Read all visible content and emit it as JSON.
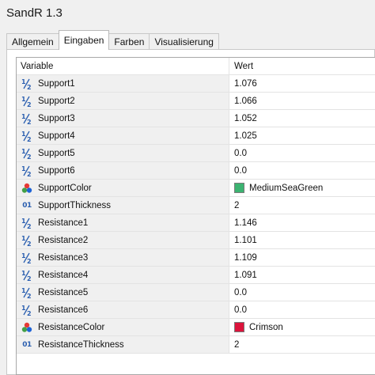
{
  "window": {
    "title": "SandR 1.3"
  },
  "tabs": [
    {
      "label": "Allgemein",
      "active": false
    },
    {
      "label": "Eingaben",
      "active": true
    },
    {
      "label": "Farben",
      "active": false
    },
    {
      "label": "Visualisierung",
      "active": false
    }
  ],
  "table": {
    "headers": {
      "variable": "Variable",
      "value": "Wert"
    },
    "rows": [
      {
        "name": "Support1",
        "value": "1.076",
        "icon": "fraction-icon"
      },
      {
        "name": "Support2",
        "value": "1.066",
        "icon": "fraction-icon"
      },
      {
        "name": "Support3",
        "value": "1.052",
        "icon": "fraction-icon"
      },
      {
        "name": "Support4",
        "value": "1.025",
        "icon": "fraction-icon"
      },
      {
        "name": "Support5",
        "value": "0.0",
        "icon": "fraction-icon"
      },
      {
        "name": "Support6",
        "value": "0.0",
        "icon": "fraction-icon"
      },
      {
        "name": "SupportColor",
        "value": "MediumSeaGreen",
        "icon": "color-palette-icon",
        "swatch": "#3cb371"
      },
      {
        "name": "SupportThickness",
        "value": "2",
        "icon": "integer-icon"
      },
      {
        "name": "Resistance1",
        "value": "1.146",
        "icon": "fraction-icon"
      },
      {
        "name": "Resistance2",
        "value": "1.101",
        "icon": "fraction-icon"
      },
      {
        "name": "Resistance3",
        "value": "1.109",
        "icon": "fraction-icon"
      },
      {
        "name": "Resistance4",
        "value": "1.091",
        "icon": "fraction-icon"
      },
      {
        "name": "Resistance5",
        "value": "0.0",
        "icon": "fraction-icon"
      },
      {
        "name": "Resistance6",
        "value": "0.0",
        "icon": "fraction-icon"
      },
      {
        "name": "ResistanceColor",
        "value": "Crimson",
        "icon": "color-palette-icon",
        "swatch": "#dc143c"
      },
      {
        "name": "ResistanceThickness",
        "value": "2",
        "icon": "integer-icon"
      }
    ]
  },
  "icons": {
    "integer_text": "01"
  }
}
